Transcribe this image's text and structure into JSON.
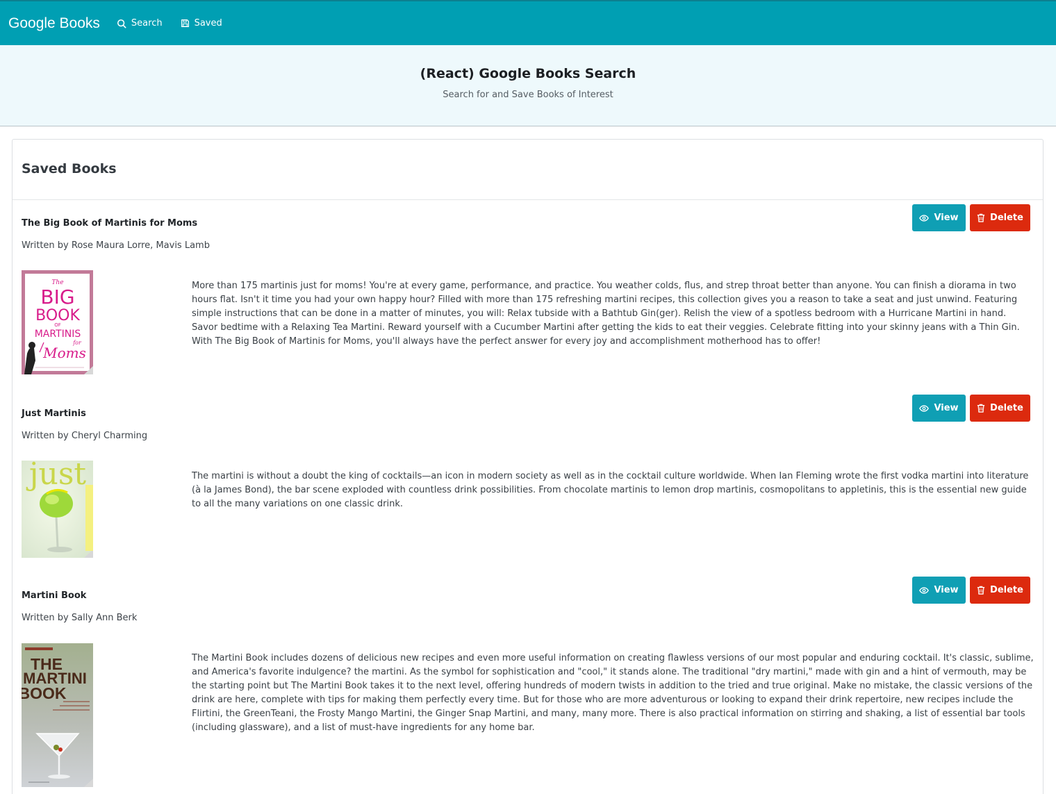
{
  "navbar": {
    "brand": "Google Books",
    "links": [
      {
        "label": "Search",
        "icon": "search-icon"
      },
      {
        "label": "Saved",
        "icon": "save-icon"
      }
    ]
  },
  "jumbotron": {
    "title": "(React) Google Books Search",
    "subtitle": "Search for and Save Books of Interest"
  },
  "card": {
    "title": "Saved Books"
  },
  "buttons": {
    "view_label": "View",
    "delete_label": "Delete"
  },
  "books": [
    {
      "title": "The Big Book of Martinis for Moms",
      "authors": "Written by Rose Maura Lorre, Mavis Lamb",
      "cover_text": [
        "The",
        "BIG",
        "BOOK",
        "OF",
        "MARTINIS",
        "for",
        "Moms"
      ],
      "description": "More than 175 martinis just for moms! You're at every game, performance, and practice. You weather colds, flus, and strep throat better than anyone. You can finish a diorama in two hours flat. Isn't it time you had your own happy hour? Filled with more than 175 refreshing martini recipes, this collection gives you a reason to take a seat and just unwind. Featuring simple instructions that can be done in a matter of minutes, you will: Relax tubside with a Bathtub Gin(ger). Relish the view of a spotless bedroom with a Hurricane Martini in hand. Savor bedtime with a Relaxing Tea Martini. Reward yourself with a Cucumber Martini after getting the kids to eat their veggies. Celebrate fitting into your skinny jeans with a Thin Gin. With The Big Book of Martinis for Moms, you'll always have the perfect answer for every joy and accomplishment motherhood has to offer!"
    },
    {
      "title": "Just Martinis",
      "authors": "Written by Cheryl Charming",
      "cover_text": [
        "just"
      ],
      "description": "The martini is without a doubt the king of cocktails—an icon in modern society as well as in the cocktail culture worldwide. When Ian Fleming wrote the first vodka martini into literature (à la James Bond), the bar scene exploded with countless drink possibilities. From chocolate martinis to lemon drop martinis, cosmopolitans to appletinis, this is the essential new guide to all the many variations on one classic drink."
    },
    {
      "title": "Martini Book",
      "authors": "Written by Sally Ann Berk",
      "cover_text": [
        "THE",
        "MARTINI",
        "BOOK"
      ],
      "description": "The Martini Book includes dozens of delicious new recipes and even more useful information on creating flawless versions of our most popular and enduring cocktail. It's classic, sublime, and America's favorite indulgence? the martini. As the symbol for sophistication and \"cool,\" it stands alone. The traditional \"dry martini,\" made with gin and a hint of vermouth, may be the starting point but The Martini Book takes it to the next level, offering hundreds of modern twists in addition to the tried and true original. Make no mistake, the classic versions of the drink are here, complete with tips for making them perfectly every time. But for those who are more adventurous or looking to expand their drink repertoire, new recipes include the Flirtini, the GreenTeani, the Frosty Mango Martini, the Ginger Snap Martini, and many, many more. There is also practical information on stirring and shaking, a list of essential bar tools (including glassware), and a list of must-have ingredients for any home bar."
    }
  ],
  "colors": {
    "primary": "#009fb3",
    "danger": "#dc2a0e",
    "jumbotron_bg": "#eef9fc"
  }
}
